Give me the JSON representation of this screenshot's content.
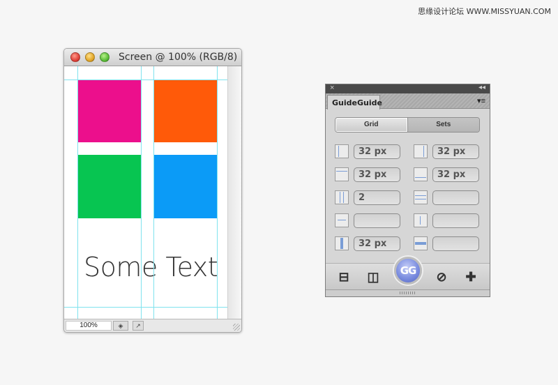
{
  "watermark": "思缘设计论坛 WWW.MISSYUAN.COM",
  "document": {
    "title": "Screen @ 100% (RGB/8)",
    "zoom": "100%",
    "canvas_text": "Some Text",
    "swatch_colors": [
      "#ec0f8c",
      "#ff5a09",
      "#07c551",
      "#0b9bf7"
    ]
  },
  "panel": {
    "tab_label": "GuideGuide",
    "close_glyph": "×",
    "collapse_glyph": "◂◂",
    "menu_glyph": "▾≡",
    "segments": {
      "grid": "Grid",
      "sets": "Sets"
    },
    "fields": {
      "left_margin": "32 px",
      "top_margin": "32 px",
      "right_margin": "32 px",
      "bottom_margin": "32 px",
      "columns": "2",
      "rows": "",
      "column_width": "",
      "row_height": "",
      "column_gutter": "32 px",
      "row_gutter": ""
    },
    "gg_button": "GG",
    "tools": {
      "horizontal_midpoint_icon": "⊟",
      "vertical_midpoint_icon": "◫",
      "clear_icon": "⊘",
      "add_icon": "✚"
    }
  }
}
